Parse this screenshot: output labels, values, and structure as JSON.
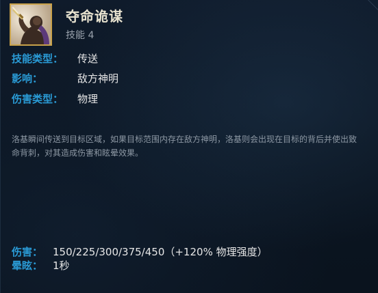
{
  "ability": {
    "name": "夺命诡谋",
    "slot_label": "技能 4",
    "icon": "assassin-portrait-icon"
  },
  "attributes": [
    {
      "label": "技能类型：",
      "value": "传送"
    },
    {
      "label": "影响：",
      "value": "敌方神明"
    },
    {
      "label": "伤害类型：",
      "value": "物理"
    }
  ],
  "description": "洛基瞬间传送到目标区域，如果目标范围内存在敌方神明，洛基则会出现在目标的背后并使出致命背刺，对其造成伤害和眩晕效果。",
  "stats": [
    {
      "label": "伤害：",
      "value": "150/225/300/375/450（+120% 物理强度）"
    },
    {
      "label": "晕眩：",
      "value": "1秒"
    }
  ],
  "colors": {
    "background": "#0b1420",
    "label_blue": "#2a9bd6",
    "title": "#e7e2cf",
    "value": "#e7e7e7",
    "description": "#8d98a4",
    "icon_border": "#c9a24a"
  }
}
